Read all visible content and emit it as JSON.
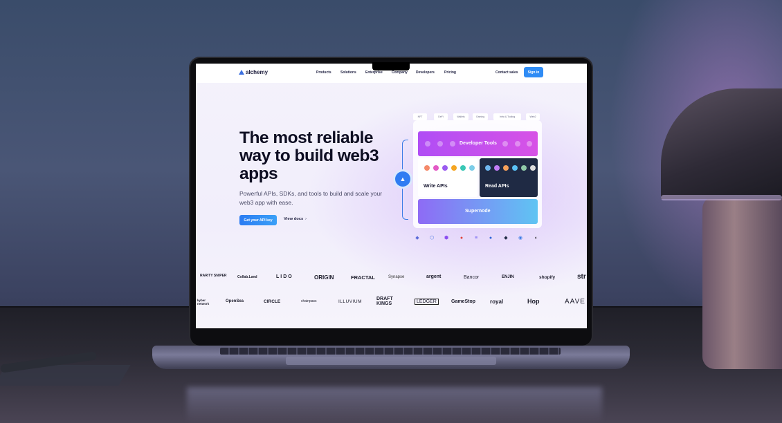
{
  "site": {
    "logo": "alchemy",
    "nav": [
      "Products",
      "Solutions",
      "Enterprise",
      "Company",
      "Developers",
      "Pricing"
    ],
    "contact": "Contact sales",
    "signin": "Sign in"
  },
  "hero": {
    "title": "The most reliable way to build web3 apps",
    "subtitle": "Powerful APIs, SDKs, and tools to build and scale your web3 app with ease.",
    "cta": "Get your API key",
    "docs": "View docs"
  },
  "diagram": {
    "tags": [
      "NFT",
      "DeFi",
      "Wallets",
      "Gaming",
      "Infra & Tooling",
      "Web2"
    ],
    "developer_tools": "Developer Tools",
    "write_apis": "Write APIs",
    "read_apis": "Read APIs",
    "supernode": "Supernode"
  },
  "logos_row1": [
    "RARITY SNIPER",
    "Collab.Land",
    "LIDO",
    "ORIGIN",
    "FRACTAL",
    "Synapse",
    "argent",
    "Bancor",
    "ENJIN",
    "shopify",
    "str"
  ],
  "logos_row2": [
    "kyber network",
    "OpenSea",
    "CIRCLE",
    "chainpass",
    "ILLUVIUM",
    "DRAFT KINGS",
    "LEDGER",
    "GameStop",
    "royal",
    "Hop",
    "AAVE"
  ],
  "colors": {
    "accent": "#2f8cf5",
    "dev_tools": "#c050ee",
    "read_card": "#1f2a44",
    "supernode_start": "#8e6bf5",
    "supernode_end": "#5fc4f3"
  }
}
